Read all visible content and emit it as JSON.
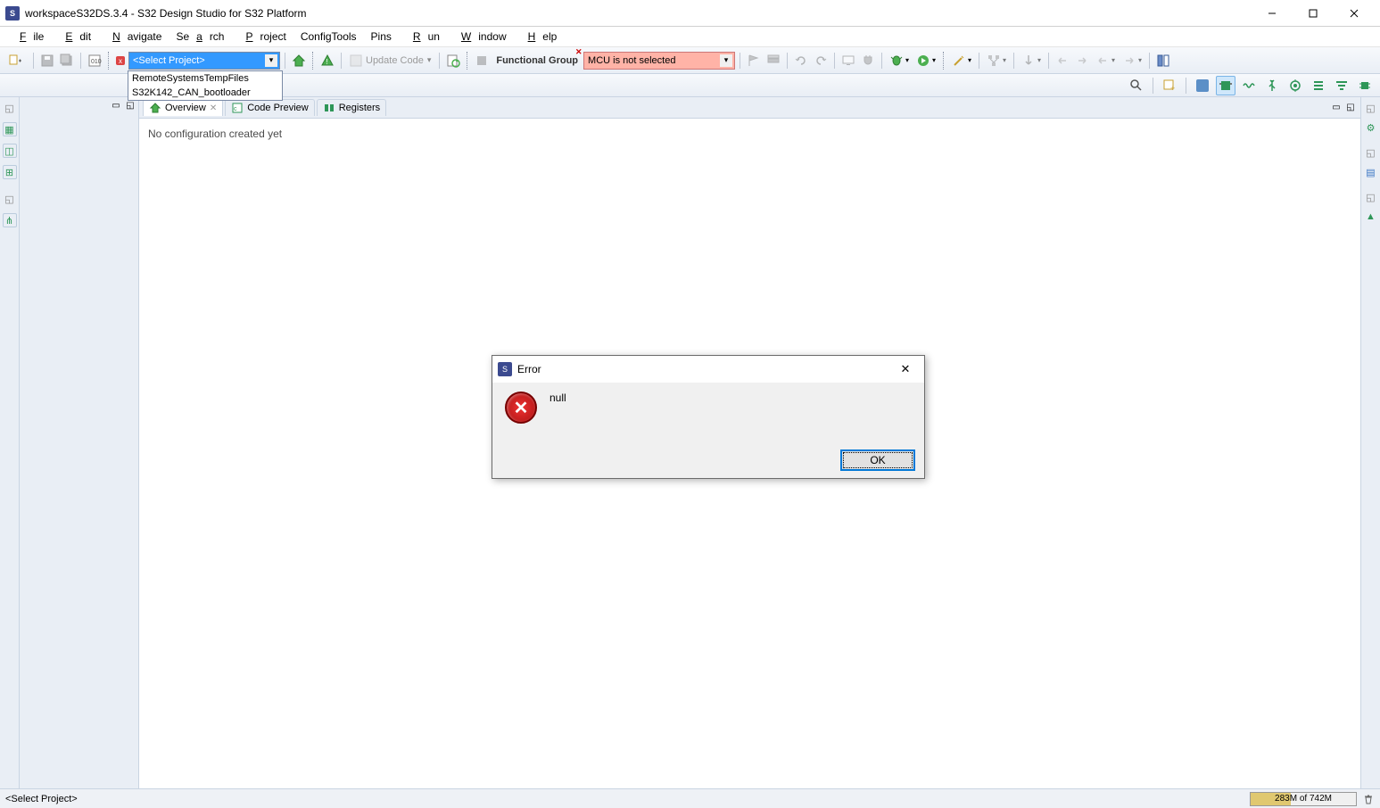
{
  "window": {
    "title": "workspaceS32DS.3.4 - S32 Design Studio for S32 Platform",
    "app_icon_text": "S"
  },
  "menu": {
    "file": "File",
    "edit": "Edit",
    "navigate": "Navigate",
    "search": "Search",
    "project": "Project",
    "configtools": "ConfigTools",
    "pins": "Pins",
    "run": "Run",
    "window": "Window",
    "help": "Help"
  },
  "toolbar": {
    "project_select_value": "<Select Project>",
    "project_options": {
      "opt1": "RemoteSystemsTempFiles",
      "opt2": "S32K142_CAN_bootloader"
    },
    "update_code_label": "Update Code",
    "functional_group_label": "Functional Group",
    "mcu_select_value": "MCU is not selected"
  },
  "tabs": {
    "overview": "Overview",
    "code_preview": "Code Preview",
    "registers": "Registers"
  },
  "editor": {
    "placeholder_text": "No configuration created yet"
  },
  "dialog": {
    "title": "Error",
    "message": "null",
    "ok_label": "OK"
  },
  "statusbar": {
    "left_text": "<Select Project>",
    "heap_text": "283M of 742M"
  }
}
